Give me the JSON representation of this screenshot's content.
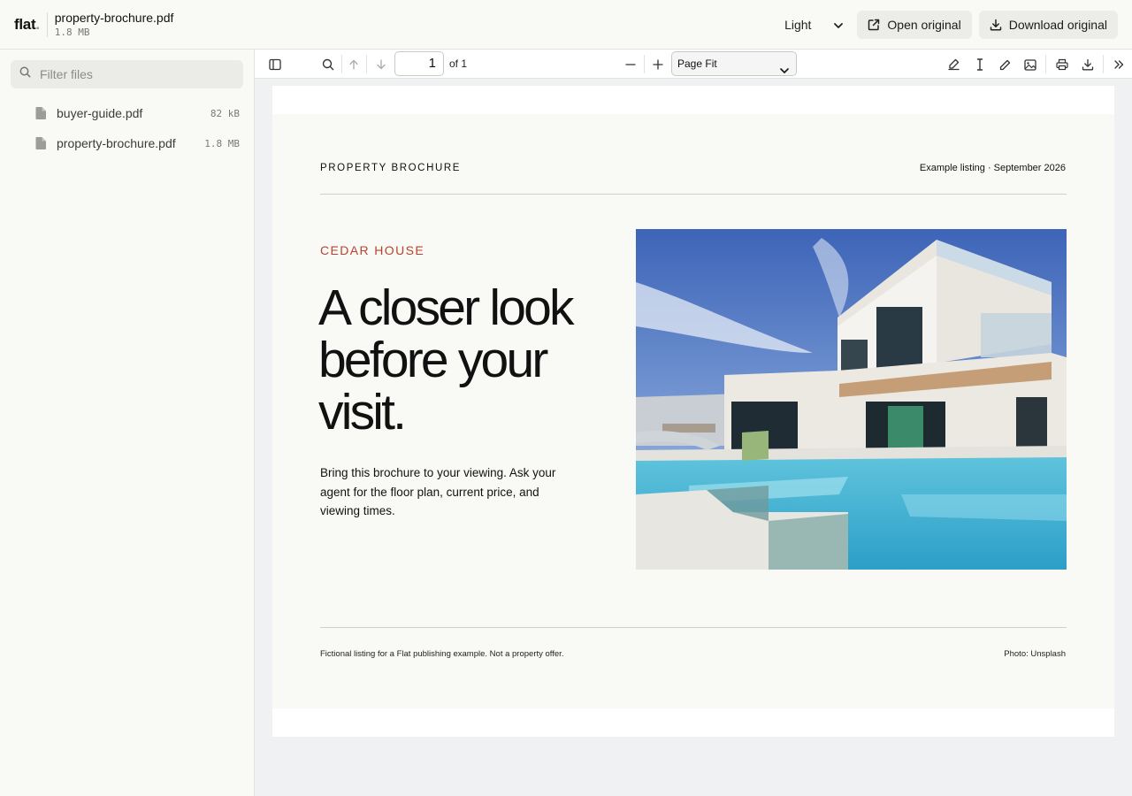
{
  "app": {
    "logo": "flat",
    "logo_dot": "."
  },
  "file": {
    "title": "property-brochure.pdf",
    "size": "1.8 MB"
  },
  "header": {
    "theme": "Light",
    "open_label": "Open original",
    "download_label": "Download original"
  },
  "sidebar": {
    "filter_placeholder": "Filter files",
    "files": [
      {
        "name": "buyer-guide.pdf",
        "size": "82 kB"
      },
      {
        "name": "property-brochure.pdf",
        "size": "1.8 MB"
      }
    ]
  },
  "toolbar": {
    "page_value": "1",
    "page_total": "of 1",
    "zoom": "Page Fit"
  },
  "document": {
    "brochure_label": "PROPERTY BROCHURE",
    "listing_meta": "Example listing · September 2026",
    "eyebrow": "CEDAR HOUSE",
    "headline": "A closer look before your visit.",
    "body": "Bring this brochure to your viewing. Ask your agent for the floor plan, current price, and viewing times.",
    "footnote": "Fictional listing for a Flat publishing example. Not a property offer.",
    "credit": "Photo: Unsplash"
  },
  "colors": {
    "accent": "#b8432e",
    "sidebar_bg": "#f9faf6",
    "page_bg": "#f9faf5"
  }
}
